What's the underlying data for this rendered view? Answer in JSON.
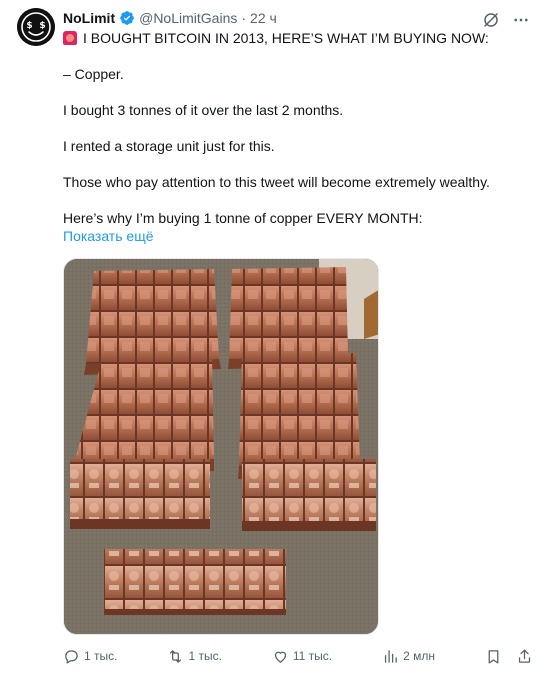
{
  "author": {
    "display_name": "NoLimit",
    "handle": "@NoLimitGains",
    "separator": "·",
    "time": "22 ч",
    "verified": true,
    "avatar_icon": "dollar-face-avatar"
  },
  "tweet": {
    "headline": "I BOUGHT BITCOIN IN 2013, HERE’S WHAT I’M BUYING NOW:",
    "headline_icon": "siren-emoji",
    "lines": [
      "– Copper.",
      "I bought 3 tonnes of it over the last 2 months.",
      "I rented a storage unit just for this.",
      "Those who pay attention to this tweet will become extremely wealthy.",
      "Here’s why I’m buying 1 tonne of copper EVERY MONTH:"
    ],
    "show_more": "Показать ещё"
  },
  "actions": {
    "replies": "1 тыс.",
    "retweets": "1 тыс.",
    "likes": "11 тыс.",
    "views": "2 млн"
  },
  "colors": {
    "link": "#1d9bf0",
    "verified": "#1d9bf0",
    "muted": "#536471",
    "copper": "#b66f51"
  }
}
